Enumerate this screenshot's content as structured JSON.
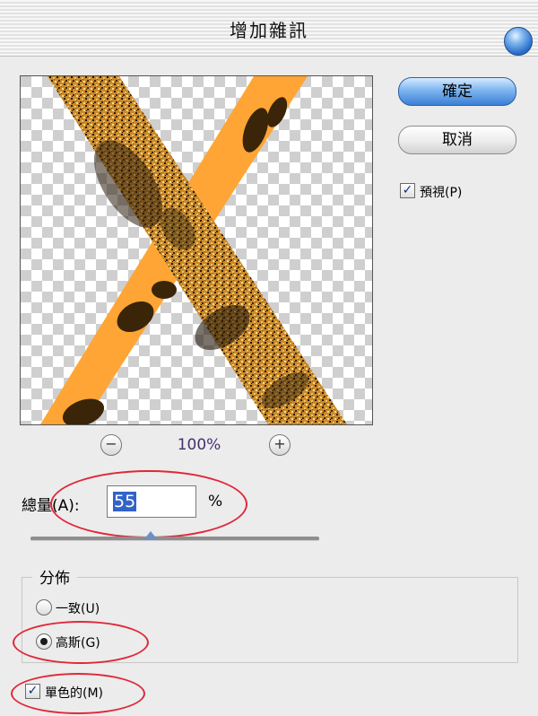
{
  "dialog": {
    "title": "增加雜訊"
  },
  "buttons": {
    "ok": "確定",
    "cancel": "取消"
  },
  "preview_checkbox": {
    "label": "預視(P)",
    "checked": true
  },
  "zoom": {
    "minus": "−",
    "plus": "+",
    "value": "100%"
  },
  "amount": {
    "label": "總量(A):",
    "value": "55",
    "unit": "%",
    "slider_percent": 55
  },
  "distribution": {
    "title": "分佈",
    "options": [
      {
        "label": "一致(U)",
        "selected": false
      },
      {
        "label": "高斯(G)",
        "selected": true
      }
    ]
  },
  "monochrome": {
    "label": "單色的(M)",
    "checked": true
  },
  "icons": {
    "check": "✓"
  },
  "colors": {
    "accent_ring": "#e0283a",
    "stripe": "#ffa535",
    "selection": "#3263c8"
  }
}
